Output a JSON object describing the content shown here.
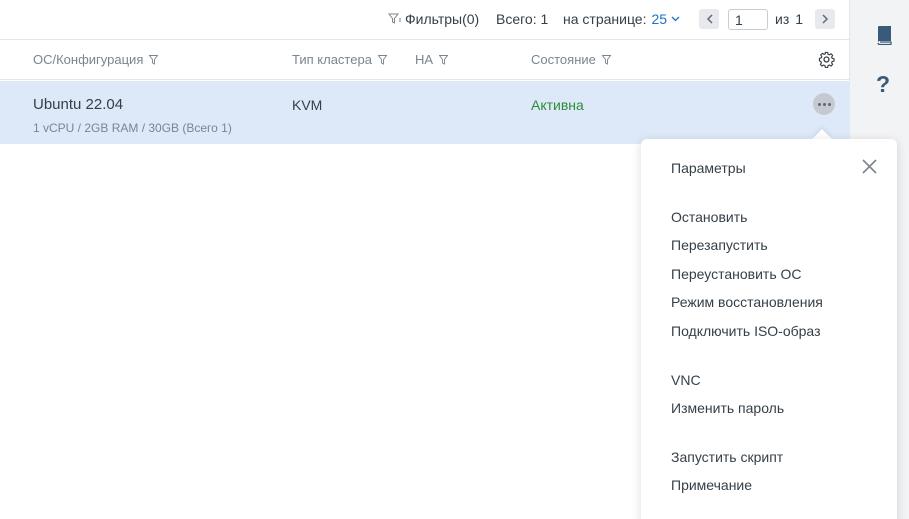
{
  "toolbar": {
    "filters_label": "Фильтры(0)",
    "total_label": "Всего: 1",
    "per_page_label": "на странице:",
    "per_page_value": "25",
    "page_input_value": "1",
    "page_of_label": "из",
    "page_total": "1",
    "icons": {
      "filter": "filter-icon",
      "per_page_dropdown": "chevron-down-icon",
      "prev": "chevron-left-icon",
      "next": "chevron-right-icon"
    }
  },
  "table": {
    "columns": [
      {
        "label": "ОС/Конфигурация"
      },
      {
        "label": "Тип кластера"
      },
      {
        "label": "HA"
      },
      {
        "label": "Состояние"
      }
    ],
    "rows": [
      {
        "os": "Ubuntu 22.04",
        "config": "1 vCPU / 2GB RAM / 30GB (Всего 1)",
        "cluster": "KVM",
        "state": "Активна"
      }
    ],
    "settings_icon": "gear-icon",
    "row_actions_icon": "more-horizontal-icon"
  },
  "colors": {
    "accent": "#1a73c8",
    "active_state": "#2e8b3a",
    "selected_row": "#dde9f8"
  },
  "context_menu": {
    "items": [
      "Параметры",
      "Остановить",
      "Перезапустить",
      "Переустановить ОС",
      "Режим восстановления",
      "Подключить ISO-образ",
      "VNC",
      "Изменить пароль",
      "Запустить скрипт",
      "Примечание"
    ],
    "close_icon": "close-icon"
  },
  "right_rail": {
    "icons": [
      "book-icon",
      "help-icon"
    ],
    "help_glyph": "?"
  }
}
